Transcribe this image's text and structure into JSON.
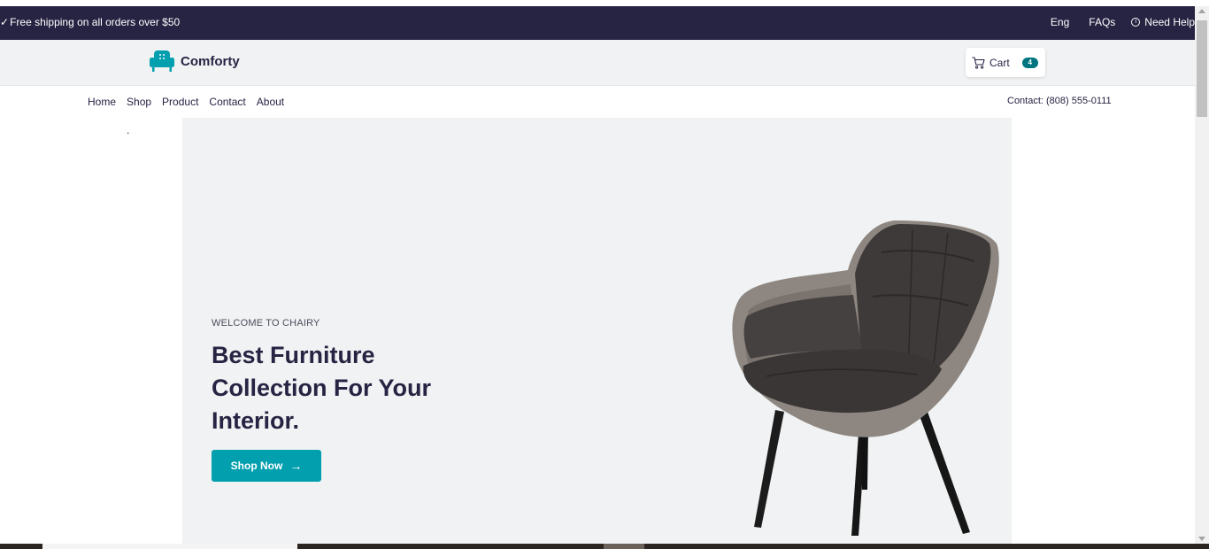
{
  "topbar": {
    "shipping_text": "Free shipping on all orders over $50",
    "language": "Eng",
    "faqs": "FAQs",
    "help": "Need Help"
  },
  "header": {
    "brand": "Comforty",
    "cart_label": "Cart",
    "cart_count": "4"
  },
  "nav": {
    "items": [
      {
        "label": "Home"
      },
      {
        "label": "Shop"
      },
      {
        "label": "Product"
      },
      {
        "label": "Contact"
      },
      {
        "label": "About"
      }
    ],
    "contact": "Contact: (808) 555-0111"
  },
  "stray_text": ".",
  "hero": {
    "eyebrow": "WELCOME TO CHAIRY",
    "title": "Best Furniture Collection For Your Interior.",
    "button_label": "Shop Now",
    "button_arrow": "→"
  },
  "colors": {
    "topbar_bg": "#272343",
    "accent": "#029fae",
    "badge": "#007580",
    "hero_bg": "#f0f2f3"
  },
  "icons": [
    "check-icon",
    "info-icon",
    "sofa-logo-icon",
    "cart-icon",
    "arrow-right-icon"
  ]
}
